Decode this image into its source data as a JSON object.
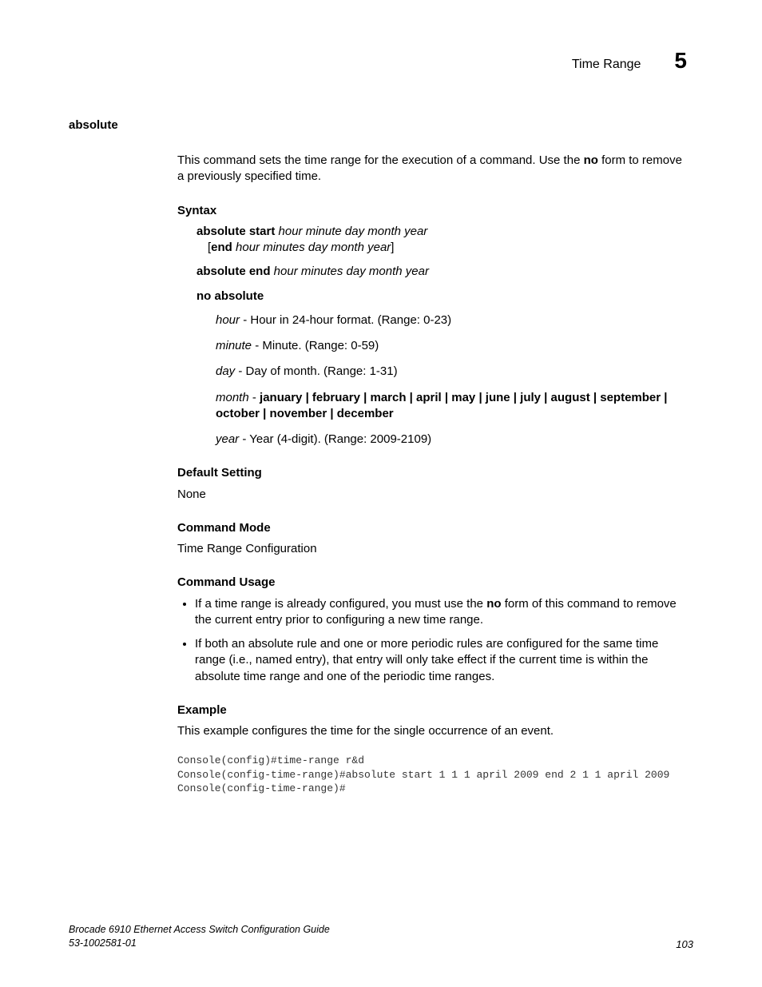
{
  "header": {
    "title": "Time Range",
    "chapter": "5"
  },
  "command_name": "absolute",
  "intro_pre": "This command sets the time range for the execution of a command. Use the ",
  "intro_no": "no",
  "intro_post": " form to remove a previously specified time.",
  "syntax": {
    "heading": "Syntax",
    "line1_bold": "absolute start",
    "line1_italic": " hour minute day month year",
    "line2_open": "[",
    "line2_bold": "end",
    "line2_italic": " hour minutes day month year",
    "line2_close": "]",
    "line3_bold": "absolute end",
    "line3_italic": " hour minutes day month year",
    "line4_bold": "no absolute"
  },
  "params": {
    "hour_name": "hour",
    "hour_desc": " - Hour in 24-hour format. (Range: 0-23)",
    "minute_name": "minute",
    "minute_desc": " - Minute. (Range: 0-59)",
    "day_name": "day",
    "day_desc": " - Day of month. (Range: 1-31)",
    "month_name": "month",
    "month_sep": " - ",
    "month_bold": "january | february | march | april | may | june | july | august | september | october | november | december",
    "year_name": "year",
    "year_desc": " - Year (4-digit). (Range: 2009-2109)"
  },
  "default": {
    "heading": "Default Setting",
    "text": "None"
  },
  "mode": {
    "heading": "Command Mode",
    "text": "Time Range Configuration"
  },
  "usage": {
    "heading": "Command Usage",
    "item1_pre": "If a time range is already configured, you must use the ",
    "item1_bold": "no",
    "item1_post": " form of this command to remove the current entry prior to configuring a new time range.",
    "item2": "If both an absolute rule and one or more periodic rules are configured for the same time range (i.e., named entry), that entry will only take effect if the current time is within the absolute time range and one of the periodic time ranges."
  },
  "example": {
    "heading": "Example",
    "text": "This example configures the time for the single occurrence of an event.",
    "code": "Console(config)#time-range r&d\nConsole(config-time-range)#absolute start 1 1 1 april 2009 end 2 1 1 april 2009\nConsole(config-time-range)#"
  },
  "footer": {
    "doc_title": "Brocade 6910 Ethernet Access Switch Configuration Guide",
    "doc_number": "53-1002581-01",
    "page": "103"
  }
}
